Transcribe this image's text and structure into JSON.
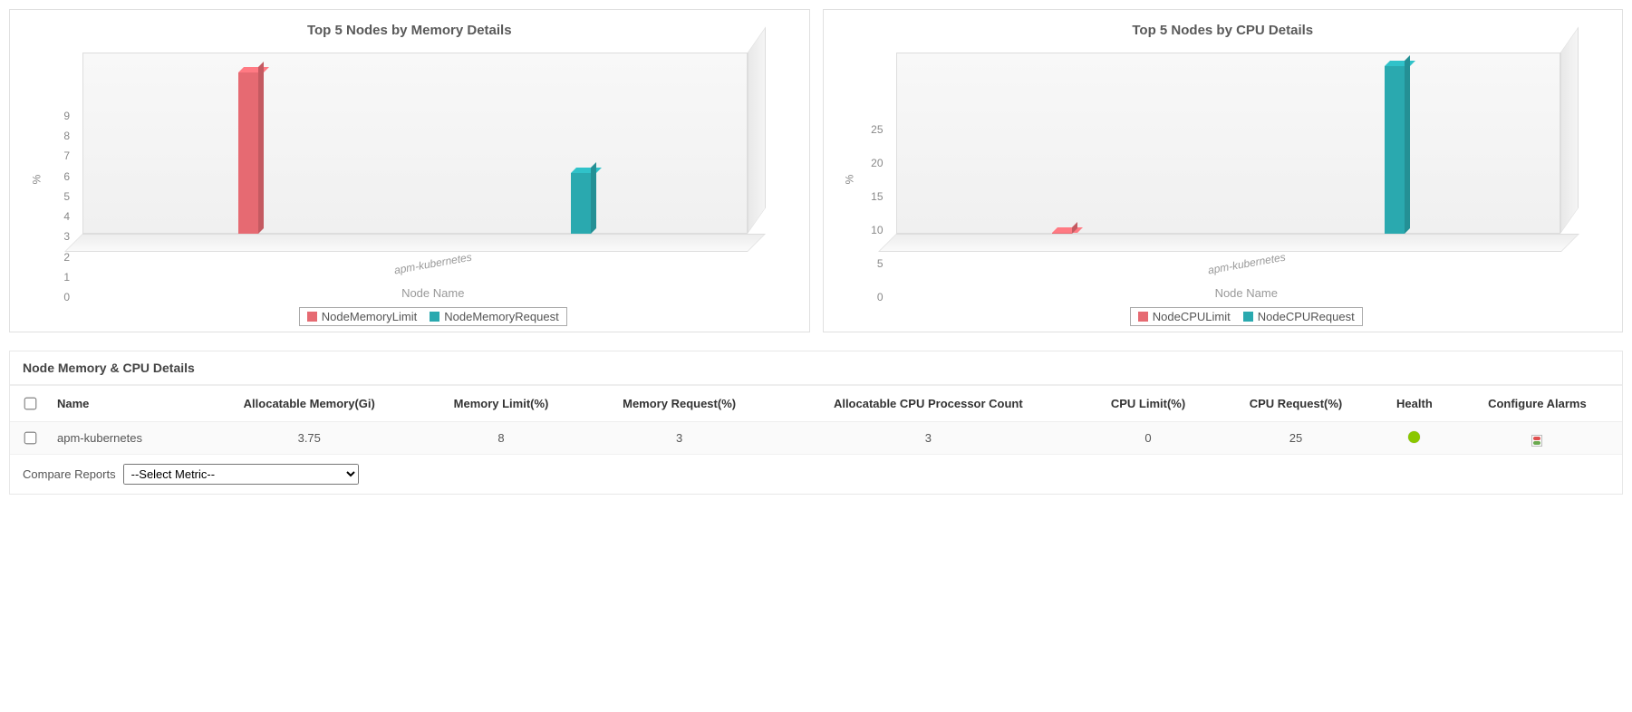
{
  "colors": {
    "series1": "#e66a72",
    "series2": "#2aa9af"
  },
  "charts": {
    "mem": {
      "title": "Top 5 Nodes by Memory Details",
      "xlabel": "Node Name",
      "ylabel": "%",
      "category": "apm-kubernetes",
      "legend": [
        "NodeMemoryLimit",
        "NodeMemoryRequest"
      ]
    },
    "cpu": {
      "title": "Top 5 Nodes by CPU Details",
      "xlabel": "Node Name",
      "ylabel": "%",
      "category": "apm-kubernetes",
      "legend": [
        "NodeCPULimit",
        "NodeCPURequest"
      ]
    }
  },
  "chart_data": [
    {
      "type": "bar",
      "title": "Top 5 Nodes by Memory Details",
      "xlabel": "Node Name",
      "ylabel": "%",
      "ylim": [
        0,
        9
      ],
      "yticks": [
        0,
        1,
        2,
        3,
        4,
        5,
        6,
        7,
        8,
        9
      ],
      "categories": [
        "apm-kubernetes"
      ],
      "series": [
        {
          "name": "NodeMemoryLimit",
          "values": [
            8
          ]
        },
        {
          "name": "NodeMemoryRequest",
          "values": [
            3
          ]
        }
      ]
    },
    {
      "type": "bar",
      "title": "Top 5 Nodes by CPU Details",
      "xlabel": "Node Name",
      "ylabel": "%",
      "ylim": [
        0,
        27
      ],
      "yticks": [
        0,
        5,
        10,
        15,
        20,
        25
      ],
      "categories": [
        "apm-kubernetes"
      ],
      "series": [
        {
          "name": "NodeCPULimit",
          "values": [
            0
          ]
        },
        {
          "name": "NodeCPURequest",
          "values": [
            25
          ]
        }
      ]
    }
  ],
  "table": {
    "title": "Node Memory & CPU Details",
    "headers": {
      "name": "Name",
      "allocMem": "Allocatable Memory(Gi)",
      "memLimit": "Memory Limit(%)",
      "memReq": "Memory Request(%)",
      "allocCpu": "Allocatable CPU Processor Count",
      "cpuLimit": "CPU Limit(%)",
      "cpuReq": "CPU Request(%)",
      "health": "Health",
      "alarms": "Configure Alarms"
    },
    "rows": [
      {
        "name": "apm-kubernetes",
        "allocMem": "3.75",
        "memLimit": "8",
        "memReq": "3",
        "allocCpu": "3",
        "cpuLimit": "0",
        "cpuReq": "25"
      }
    ]
  },
  "compare": {
    "label": "Compare Reports",
    "placeholder": "--Select Metric--"
  }
}
